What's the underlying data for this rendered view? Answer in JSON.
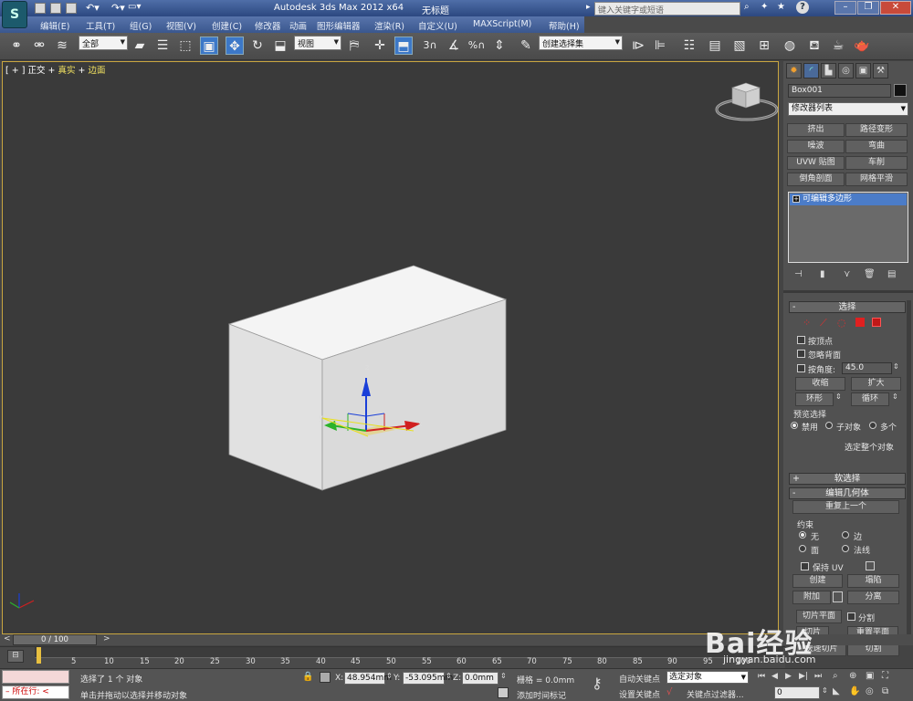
{
  "app": {
    "title": "Autodesk 3ds Max  2012 x64",
    "doc_title": "无标题",
    "search_placeholder": "键入关键字或短语"
  },
  "menu": [
    "编辑(E)",
    "工具(T)",
    "组(G)",
    "视图(V)",
    "创建(C)",
    "修改器",
    "动画",
    "图形编辑器",
    "渲染(R)",
    "自定义(U)",
    "MAXScript(M)",
    "帮助(H)"
  ],
  "toolbar": {
    "selection_filter": "全部",
    "ref_coord": "视图",
    "snap_angle": "3",
    "snap_percent": "%",
    "named_selection": "创建选择集"
  },
  "viewport": {
    "label_plus": "[ + ]",
    "label_view": "正交",
    "label_shading": "真实",
    "label_edges": "边面",
    "gizmo_axis_x": "x",
    "gizmo_axis_y": "y",
    "gizmo_axis_z": "z"
  },
  "command_panel": {
    "tabs": [
      "create-tab",
      "modify-tab",
      "hierarchy-tab",
      "motion-tab",
      "display-tab",
      "utilities-tab"
    ],
    "object_name": "Box001",
    "modifier_list": "修改器列表",
    "modifier_buttons": [
      "挤出",
      "路径变形",
      "噪波",
      "弯曲",
      "UVW 贴图",
      "车削",
      "倒角剖面",
      "网格平滑"
    ],
    "stack_items": [
      "可编辑多边形"
    ],
    "rollout_select": {
      "title": "选择",
      "by_vertex": "按顶点",
      "ignore_backfacing": "忽略背面",
      "by_angle": "按角度:",
      "angle_value": "45.0",
      "shrink": "收缩",
      "grow": "扩大",
      "ring": "环形",
      "loop": "循环",
      "preview_label": "预览选择",
      "preview_off": "禁用",
      "preview_sub": "子对象",
      "preview_multi": "多个",
      "status": "选定整个对象"
    },
    "rollout_soft": {
      "title": "软选择"
    },
    "rollout_edit_geometry": {
      "title": "编辑几何体",
      "repeat_last": "重复上一个",
      "constraints_label": "约束",
      "c_none": "无",
      "c_edge": "边",
      "c_face": "面",
      "c_normal": "法线",
      "preserve_uv": "保持 UV",
      "create": "创建",
      "collapse": "塌陷",
      "attach": "附加",
      "detach": "分离",
      "slice_plane": "切片平面",
      "split": "分割",
      "slice": "切片",
      "reset_plane": "重置平面",
      "quickslice": "快速切片",
      "cut": "切割"
    }
  },
  "timeline": {
    "frame_display": "0 / 100",
    "ticks": [
      "0",
      "5",
      "10",
      "15",
      "20",
      "25",
      "30",
      "35",
      "40",
      "45",
      "50",
      "55",
      "60",
      "65",
      "70",
      "75",
      "80",
      "85",
      "90",
      "95",
      "100"
    ]
  },
  "status": {
    "script_line": "所在行:",
    "selected_msg": "选择了 1 个 对象",
    "prompt": "单击并拖动以选择并移动对象",
    "x_label": "X:",
    "x_value": "48.954mm",
    "y_label": "Y:",
    "y_value": "-53.095mm",
    "z_label": "Z:",
    "z_value": "0.0mm",
    "grid": "栅格 = 0.0mm",
    "add_time_tag": "添加时间标记",
    "auto_key": "自动关键点",
    "set_key": "设置关键点",
    "selected_obj": "选定对象",
    "key_filters": "关键点过滤器...",
    "frame_value": "0"
  },
  "watermark": {
    "text": "Bai经验",
    "sub": "jingyan.baidu.com"
  },
  "colors": {
    "viewport_bg": "#3a3a3a",
    "viewport_border": "#c9a640",
    "accent_blue": "#3c78c8",
    "box_top": "#f4f4f4",
    "box_front": "#e3e3e3",
    "box_side": "#d2d2d2"
  }
}
